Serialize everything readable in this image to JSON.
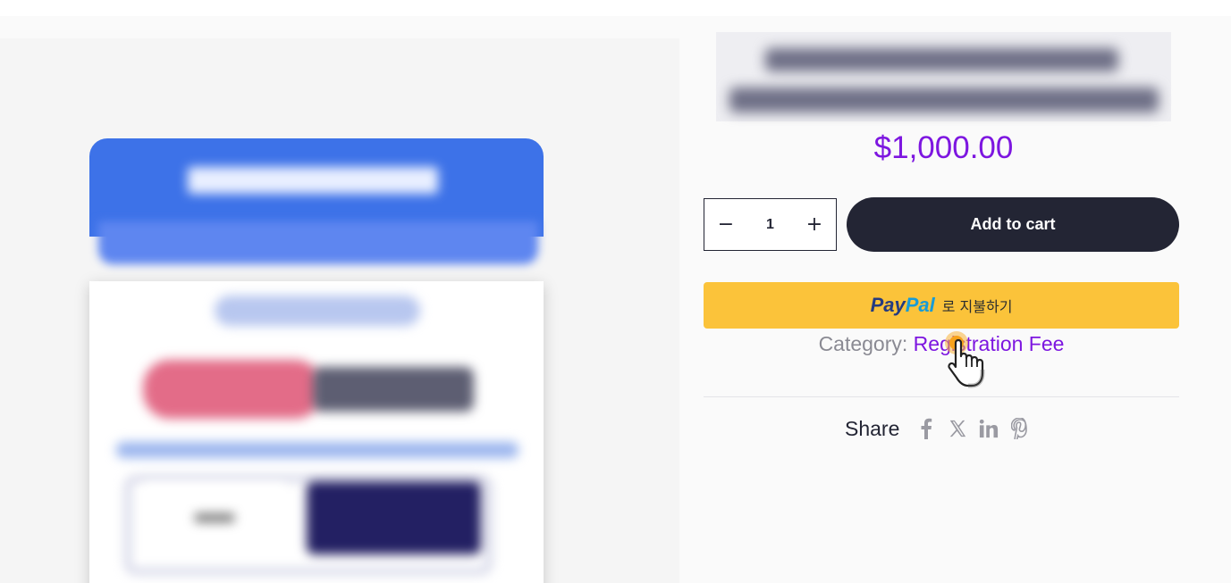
{
  "product": {
    "price": "$1,000.00",
    "quantity": "1",
    "decrement_symbol": "−",
    "increment_symbol": "+",
    "add_to_cart_label": "Add to cart",
    "paypal": {
      "logo_pay": "Pay",
      "logo_pal": "Pal",
      "label": "로 지불하기"
    },
    "category": {
      "label": "Category: ",
      "value": "Registration Fee"
    },
    "share": {
      "label": "Share",
      "icons": [
        "facebook-icon",
        "x-icon",
        "linkedin-icon",
        "pinterest-icon"
      ]
    }
  },
  "colors": {
    "accent": "#7d16e0",
    "button_dark": "#232534",
    "paypal_yellow": "#fbc33a",
    "paypal_blue_dark": "#253b80",
    "paypal_blue_light": "#179bd7",
    "card_blue": "#3d72e8"
  }
}
